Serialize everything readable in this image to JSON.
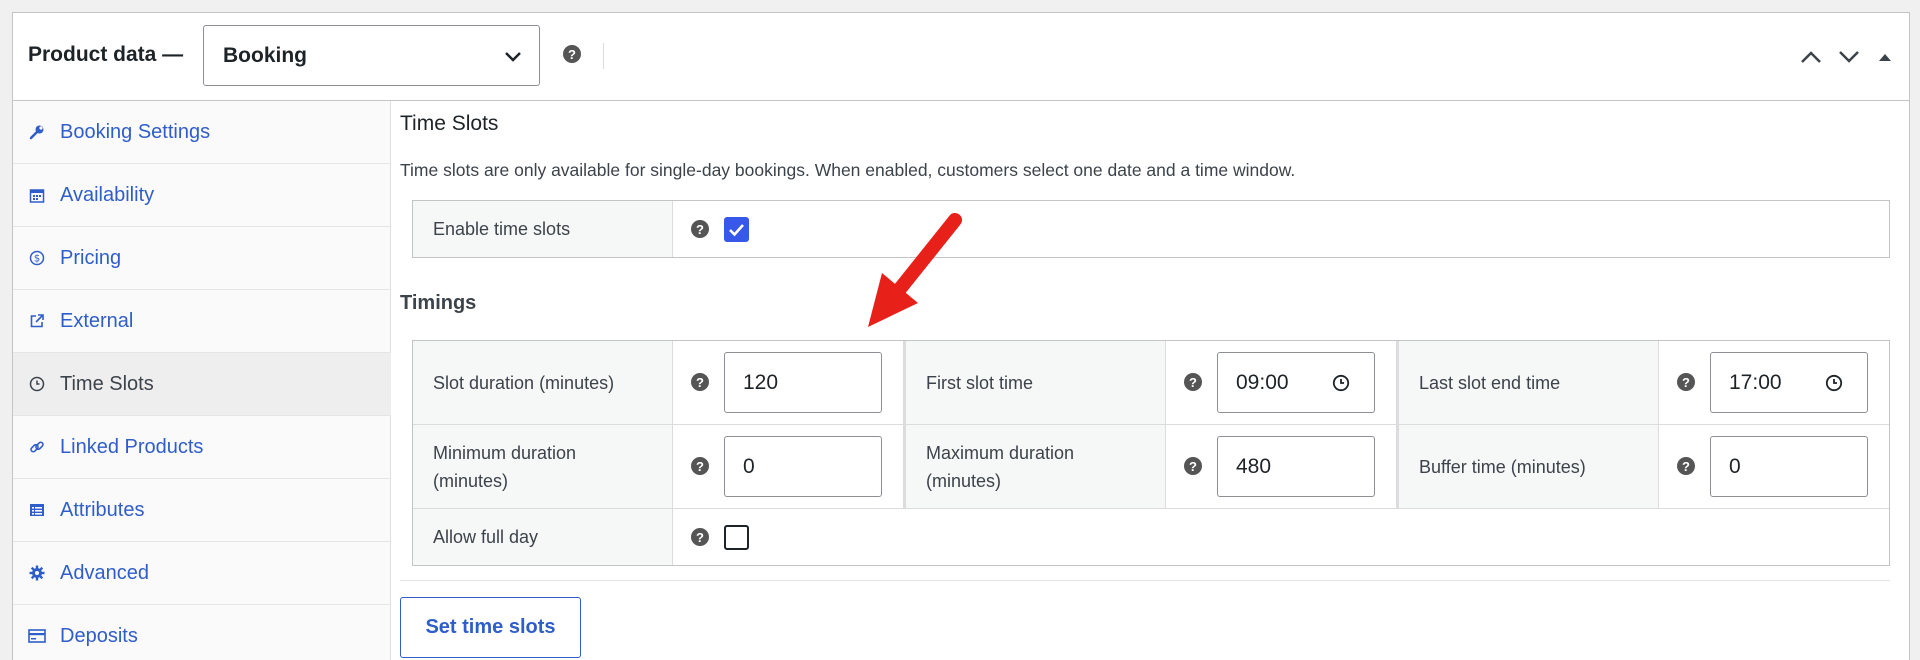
{
  "header": {
    "title": "Product data —",
    "product_type": "Booking",
    "help": "?"
  },
  "sidebar": {
    "items": [
      {
        "label": "Booking Settings",
        "icon": "wrench-icon"
      },
      {
        "label": "Availability",
        "icon": "calendar-icon"
      },
      {
        "label": "Pricing",
        "icon": "dollar-icon"
      },
      {
        "label": "External",
        "icon": "external-link-icon"
      },
      {
        "label": "Time Slots",
        "icon": "clock-icon",
        "active": true
      },
      {
        "label": "Linked Products",
        "icon": "link-icon"
      },
      {
        "label": "Attributes",
        "icon": "list-icon"
      },
      {
        "label": "Advanced",
        "icon": "gear-icon"
      },
      {
        "label": "Deposits",
        "icon": "card-icon"
      }
    ]
  },
  "time_slots": {
    "title": "Time Slots",
    "description": "Time slots are only available for single-day bookings. When enabled, customers select one date and a time window.",
    "enable_label": "Enable time slots",
    "enable_checked": true
  },
  "timings": {
    "title": "Timings",
    "slot_duration_label": "Slot duration (minutes)",
    "slot_duration_value": "120",
    "first_slot_label": "First slot time",
    "first_slot_value": "09:00",
    "last_slot_label": "Last slot end time",
    "last_slot_value": "17:00",
    "min_duration_label_1": "Minimum duration",
    "min_duration_label_2": "(minutes)",
    "min_duration_value": "0",
    "max_duration_label_1": "Maximum duration",
    "max_duration_label_2": "(minutes)",
    "max_duration_value": "480",
    "buffer_label": "Buffer time (minutes)",
    "buffer_value": "0",
    "allow_full_day_label": "Allow full day",
    "allow_full_day_checked": false
  },
  "actions": {
    "set_time_slots": "Set time slots"
  },
  "colors": {
    "link": "#2f5dc9",
    "checkbox": "#3858e9",
    "arrow": "#e8201a"
  }
}
